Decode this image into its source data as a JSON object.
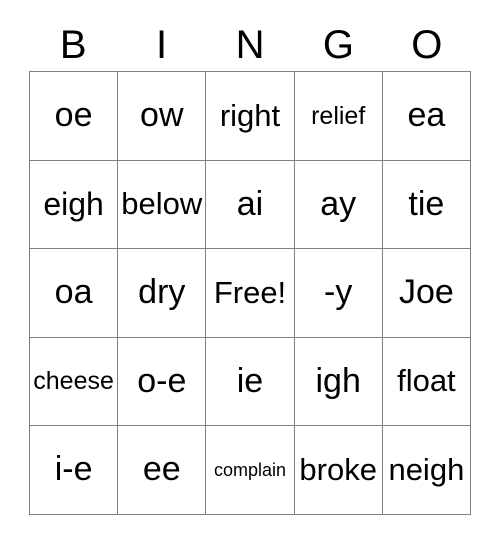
{
  "card": {
    "title_letters": [
      "B",
      "I",
      "N",
      "G",
      "O"
    ],
    "background_color": "#ffffff",
    "text_color": "#000000",
    "border_color": "#808080",
    "columns": 5,
    "rows": 5,
    "free_space_label": "Free!",
    "cells": [
      [
        {
          "text": "oe"
        },
        {
          "text": "ow"
        },
        {
          "text": "right"
        },
        {
          "text": "relief"
        },
        {
          "text": "ea"
        }
      ],
      [
        {
          "text": "eigh"
        },
        {
          "text": "below"
        },
        {
          "text": "ai"
        },
        {
          "text": "ay"
        },
        {
          "text": "tie"
        }
      ],
      [
        {
          "text": "oa"
        },
        {
          "text": "dry"
        },
        {
          "text": "Free!"
        },
        {
          "text": "-y"
        },
        {
          "text": "Joe"
        }
      ],
      [
        {
          "text": "cheese"
        },
        {
          "text": "o-e"
        },
        {
          "text": "ie"
        },
        {
          "text": "igh"
        },
        {
          "text": "float"
        }
      ],
      [
        {
          "text": "i-e"
        },
        {
          "text": "ee"
        },
        {
          "text": "complain"
        },
        {
          "text": "broke"
        },
        {
          "text": "neigh"
        }
      ]
    ]
  }
}
